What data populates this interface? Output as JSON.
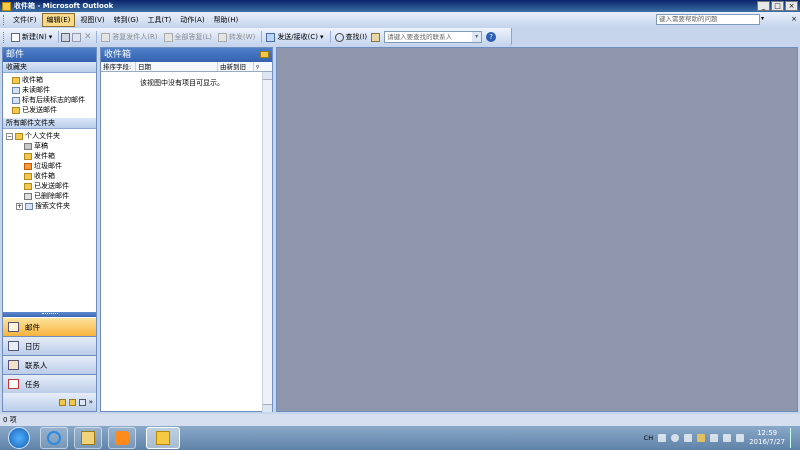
{
  "window": {
    "title": "收件箱 - Microsoft Outlook"
  },
  "menu": {
    "items": [
      "文件(F)",
      "编辑(E)",
      "视图(V)",
      "转到(G)",
      "工具(T)",
      "动作(A)",
      "帮助(H)"
    ],
    "active_index": 1,
    "help_placeholder": "键入需要帮助的问题"
  },
  "toolbar": {
    "new_label": "新建(N)",
    "reply_label": "答复发件人(R)",
    "reply_all_label": "全部答复(L)",
    "forward_label": "转发(W)",
    "send_receive_label": "发送/接收(C)",
    "find_label": "查找(I)",
    "contact_placeholder": "请键入要查找的联系人"
  },
  "nav": {
    "header": "邮件",
    "favorites_head": "收藏夹",
    "favorites": [
      "收件箱",
      "未读邮件",
      "标有后续标志的邮件",
      "已发送邮件"
    ],
    "all_folders_head": "所有邮件文件夹",
    "root_folder": "个人文件夹",
    "folders": [
      "草稿",
      "发件箱",
      "垃圾邮件",
      "收件箱",
      "已发送邮件",
      "已删除邮件",
      "搜索文件夹"
    ],
    "buttons": [
      "邮件",
      "日历",
      "联系人",
      "任务"
    ]
  },
  "inbox": {
    "header": "收件箱",
    "col_sort": "排序字段:",
    "col_date": "日期",
    "col_order": "由新到旧",
    "empty_message": "该视图中没有项目可显示。"
  },
  "status": {
    "count": "0 项"
  },
  "taskbar": {
    "lang": "CH",
    "time": "12:59",
    "date": "2016/7/27"
  }
}
